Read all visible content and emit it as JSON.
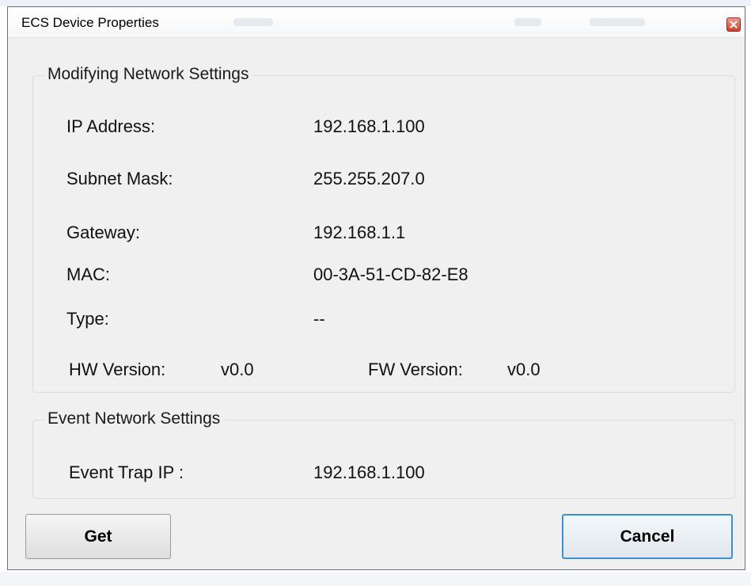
{
  "window": {
    "title": "ECS Device Properties"
  },
  "network_group": {
    "title": "Modifying Network Settings",
    "ip_label": "IP Address:",
    "ip_value": "192.168.1.100",
    "subnet_label": "Subnet Mask:",
    "subnet_value": "255.255.207.0",
    "gateway_label": "Gateway:",
    "gateway_value": "192.168.1.1",
    "mac_label": "MAC:",
    "mac_value": "00-3A-51-CD-82-E8",
    "type_label": "Type:",
    "type_value": "--",
    "hw_label": "HW Version:",
    "hw_value": "v0.0",
    "fw_label": "FW Version:",
    "fw_value": "v0.0"
  },
  "event_group": {
    "title": "Event Network Settings",
    "trap_label": "Event Trap IP :",
    "trap_value": "192.168.1.100"
  },
  "buttons": {
    "get": "Get",
    "cancel": "Cancel"
  },
  "colors": {
    "window_bg": "#f0f0f0",
    "close_button": "#c9422d",
    "default_button_border": "#3c8fd0"
  },
  "icons": {
    "close": "close-icon"
  }
}
